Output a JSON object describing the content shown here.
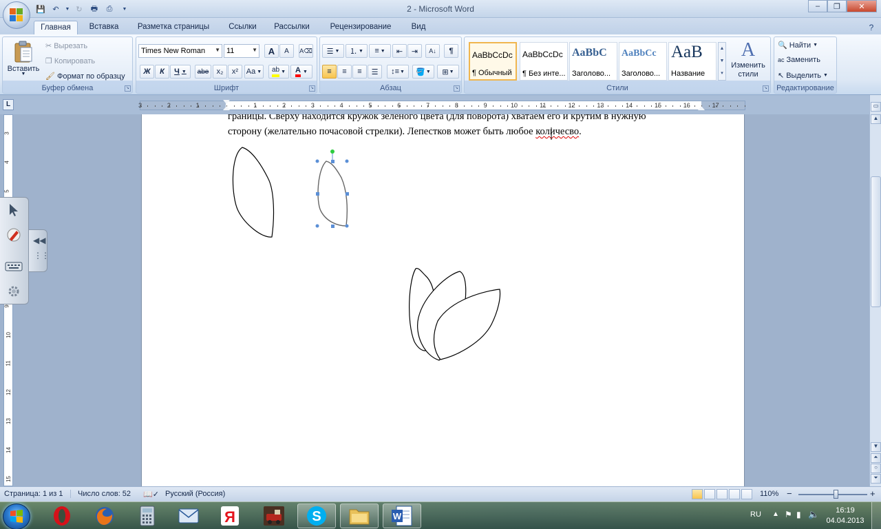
{
  "window": {
    "title": "2 - Microsoft Word",
    "minimize": "–",
    "maximize": "❐",
    "close": "✕"
  },
  "tabs": [
    "Главная",
    "Вставка",
    "Разметка страницы",
    "Ссылки",
    "Рассылки",
    "Рецензирование",
    "Вид"
  ],
  "clipboard": {
    "paste": "Вставить",
    "cut": "Вырезать",
    "copy": "Копировать",
    "format_painter": "Формат по образцу",
    "group": "Буфер обмена"
  },
  "font": {
    "name": "Times New Roman",
    "size": "11",
    "group": "Шрифт",
    "bold": "Ж",
    "italic": "К",
    "underline": "Ч",
    "strike": "abe",
    "subscript": "x₂",
    "superscript": "x²",
    "change_case": "Aa",
    "grow": "A",
    "shrink": "A"
  },
  "paragraph": {
    "group": "Абзац",
    "pilcrow": "¶"
  },
  "styles": {
    "group": "Стили",
    "items": [
      {
        "sample": "AaBbCcDc",
        "label": "¶ Обычный"
      },
      {
        "sample": "AaBbCcDc",
        "label": "¶ Без инте..."
      },
      {
        "sample": "AaBbC",
        "label": "Заголово..."
      },
      {
        "sample": "AaBbCc",
        "label": "Заголово..."
      },
      {
        "sample": "AaB",
        "label": "Название"
      }
    ],
    "change_styles": "Изменить стили"
  },
  "editing": {
    "group": "Редактирование",
    "find": "Найти",
    "replace": "Заменить",
    "select": "Выделить"
  },
  "ruler": {
    "corner": "L",
    "h_numbers": [
      "3",
      "2",
      "1",
      "1",
      "2",
      "3",
      "4",
      "5",
      "6",
      "7",
      "8",
      "9",
      "10",
      "11",
      "12",
      "13",
      "14",
      "15",
      "16",
      "17"
    ],
    "v_numbers": [
      "3",
      "4",
      "5",
      "6",
      "7",
      "8",
      "9",
      "10",
      "11",
      "12",
      "13",
      "14",
      "15"
    ]
  },
  "document": {
    "line1": "границы. Сверху находится кружок зеленого цвета (для поворота) хватаем его и крутим в нужную",
    "line2_a": "сторону (желательно  почасовой стрелки). Лепестков может быть любое ",
    "line2_b": "количесво",
    "line2_c": "."
  },
  "status": {
    "page": "Страница: 1 из 1",
    "words": "Число слов: 52",
    "language": "Русский (Россия)",
    "zoom": "110%",
    "zoom_minus": "−",
    "zoom_plus": "+",
    "zoom_level_fraction": 0.55
  },
  "taskbar": {
    "lang": "RU",
    "time": "16:19",
    "date": "04.04.2013",
    "apps": [
      "opera-icon",
      "firefox-icon",
      "calculator-icon",
      "mail-icon",
      "yandex-icon",
      "game-icon",
      "skype-icon",
      "folder-icon",
      "word-icon"
    ]
  },
  "colors": {
    "highlight": "#ffff00",
    "font_color": "#ff0000",
    "rotate_handle": "#2ecc40",
    "selection_handle": "#5b8fd6"
  }
}
